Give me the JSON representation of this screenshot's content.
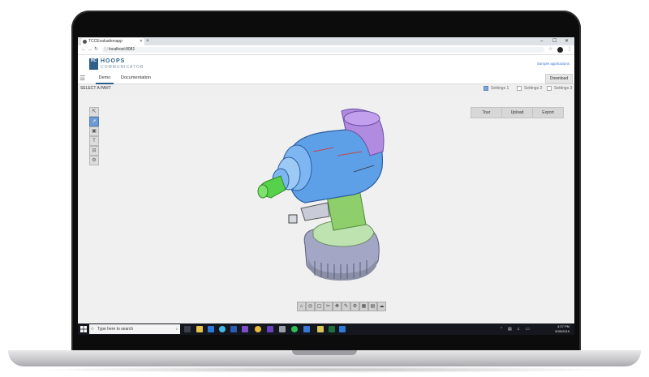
{
  "browser": {
    "tab_title": "TCCEvaluationapp",
    "url": "localhost:8081",
    "new_tab_symbol": "+",
    "minimize": "–",
    "maximize": "☐",
    "close": "✕"
  },
  "app": {
    "logo_mark": "HC",
    "logo_title": "HOOPS",
    "logo_subtitle": "COMMUNICATOR",
    "sample_link": "Sample applications"
  },
  "nav": {
    "tabs": [
      "Demo",
      "Documentation"
    ],
    "download_label": "Download"
  },
  "toolbar": {
    "select_label": "SELECT A PART",
    "settings": [
      {
        "label": "Settings 1",
        "checked": true
      },
      {
        "label": "Settings 2",
        "checked": false
      },
      {
        "label": "Settings 3",
        "checked": false
      }
    ]
  },
  "viewer": {
    "buttons": [
      "Tour",
      "Upload",
      "Export"
    ],
    "side_tools": [
      "cursor-icon",
      "select-icon",
      "cube-icon",
      "text-icon",
      "measure-icon",
      "settings-icon"
    ],
    "bottom_tools": [
      "home-icon",
      "camera-icon",
      "view-icon",
      "cut-icon",
      "explode-icon",
      "draw-icon",
      "settings-icon",
      "model-icon",
      "snapshot-icon",
      "cloud-icon"
    ]
  },
  "taskbar": {
    "search_placeholder": "Type here to search",
    "time": "4:27 PM",
    "date": "5/30/2019"
  },
  "colors": {
    "brand": "#2d5f8b",
    "drill_body": "#5da0e8",
    "drill_tip": "#58d14a",
    "drill_top": "#b18be0",
    "drill_base": "#8a8fa6"
  }
}
